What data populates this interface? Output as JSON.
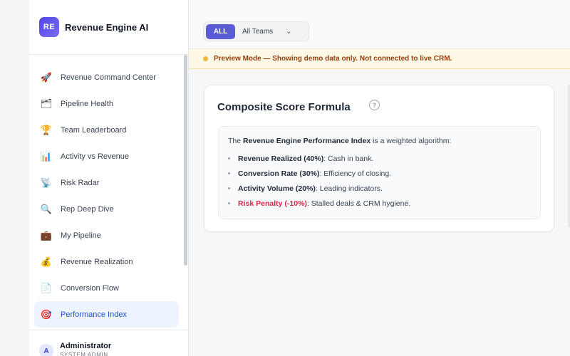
{
  "brand": {
    "logo": "RE",
    "name": "Revenue Engine AI"
  },
  "nav": [
    {
      "label": "Revenue Command Center",
      "icon": "🚀",
      "icon_name": "rocket-icon"
    },
    {
      "label": "Pipeline Health",
      "icon": "🗂",
      "icon_name": "pipeline-icon"
    },
    {
      "label": "Team Leaderboard",
      "icon": "🏆",
      "icon_name": "trophy-icon"
    },
    {
      "label": "Activity vs Revenue",
      "icon": "📊",
      "icon_name": "bar-chart-icon"
    },
    {
      "label": "Risk Radar",
      "icon": "📡",
      "icon_name": "radar-icon"
    },
    {
      "label": "Rep Deep Dive",
      "icon": "🔍",
      "icon_name": "magnifier-icon"
    },
    {
      "label": "My Pipeline",
      "icon": "💼",
      "icon_name": "briefcase-icon"
    },
    {
      "label": "Revenue Realization",
      "icon": "💰",
      "icon_name": "money-bag-icon"
    },
    {
      "label": "Conversion Flow",
      "icon": "📄",
      "icon_name": "document-icon"
    },
    {
      "label": "Performance Index",
      "icon": "🎯",
      "icon_name": "target-icon",
      "active": true
    }
  ],
  "user": {
    "initial": "A",
    "name": "Administrator",
    "role": "SYSTEM ADMIN"
  },
  "filters": {
    "all_label": "ALL",
    "team_value": "All Teams",
    "chevron": "⌄"
  },
  "banner": {
    "text": "Preview Mode — Showing demo data only. Not connected to live CRM."
  },
  "card": {
    "title": "Composite Score Formula",
    "help": "?",
    "intro_pre": "The ",
    "intro_bold": "Revenue Engine Performance Index",
    "intro_post": " is a weighted algorithm:",
    "items": [
      {
        "bold": "Revenue Realized (40%)",
        "rest": ": Cash in bank."
      },
      {
        "bold": "Conversion Rate (30%)",
        "rest": ": Efficiency of closing."
      },
      {
        "bold": "Activity Volume (20%)",
        "rest": ": Leading indicators."
      },
      {
        "bold": "Risk Penalty (-10%)",
        "rest": ": Stalled deals & CRM hygiene.",
        "penalty": true
      }
    ]
  },
  "colors": {
    "accent": "#5b5bd6",
    "active_bg": "#eef4ff",
    "penalty": "#dc2646",
    "banner_bg": "#fef9e7"
  }
}
